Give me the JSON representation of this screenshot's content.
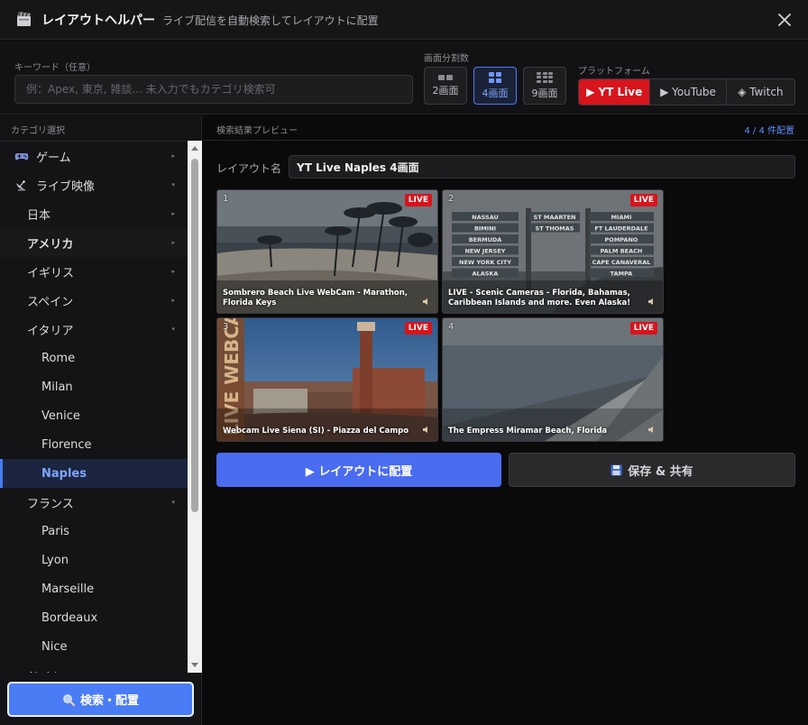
{
  "header": {
    "title": "レイアウトヘルパー",
    "subtitle": "ライブ配信を自動検索してレイアウトに配置",
    "app_icon": "clapper-board-icon",
    "close_icon": "close-icon"
  },
  "controls": {
    "keyword_label": "キーワード（任意）",
    "keyword_placeholder": "例：Apex, 東京, 雑談... 未入力でもカテゴリ検索可",
    "keyword_value": "",
    "split_label": "画面分割数",
    "splits": [
      {
        "label": "2画面",
        "active": false
      },
      {
        "label": "4画面",
        "active": true
      },
      {
        "label": "9画面",
        "active": false
      }
    ],
    "platform_label": "プラットフォーム",
    "platforms": [
      {
        "label": "▶ YT Live",
        "active": true
      },
      {
        "label": "▶ YouTube",
        "active": false
      },
      {
        "label": "◈ Twitch",
        "active": false
      }
    ]
  },
  "sidebar": {
    "heading": "カテゴリ選択",
    "items": [
      {
        "label": "ゲーム",
        "level": 0,
        "arrow": "▸",
        "icon": "gamepad-icon"
      },
      {
        "label": "ライブ映像",
        "level": 0,
        "arrow": "▾",
        "icon": "satellite-dish-icon"
      },
      {
        "label": "日本",
        "level": 1,
        "arrow": "▸"
      },
      {
        "label": "アメリカ",
        "level": 1,
        "arrow": "▸",
        "bold": true
      },
      {
        "label": "イギリス",
        "level": 1,
        "arrow": "▸"
      },
      {
        "label": "スペイン",
        "level": 1,
        "arrow": "▸"
      },
      {
        "label": "イタリア",
        "level": 1,
        "arrow": "▾"
      },
      {
        "label": "Rome",
        "level": 2
      },
      {
        "label": "Milan",
        "level": 2
      },
      {
        "label": "Venice",
        "level": 2
      },
      {
        "label": "Florence",
        "level": 2
      },
      {
        "label": "Naples",
        "level": 2,
        "selected": true
      },
      {
        "label": "フランス",
        "level": 1,
        "arrow": "▾"
      },
      {
        "label": "Paris",
        "level": 2
      },
      {
        "label": "Lyon",
        "level": 2
      },
      {
        "label": "Marseille",
        "level": 2
      },
      {
        "label": "Bordeaux",
        "level": 2
      },
      {
        "label": "Nice",
        "level": 2
      },
      {
        "label": "ドイツ",
        "level": 1,
        "arrow": "▾"
      }
    ],
    "search_button": "検索・配置",
    "search_icon": "magnifier-icon"
  },
  "main": {
    "preview_label": "検索結果プレビュー",
    "count": "4 / 4 件配置",
    "layout_name_label": "レイアウト名",
    "layout_name_value": "YT Live Naples 4画面",
    "tiles": [
      {
        "num": "1",
        "badge": "LIVE",
        "caption": "Sombrero Beach Live WebCam - Marathon, Florida Keys"
      },
      {
        "num": "2",
        "badge": "LIVE",
        "caption": "LIVE - Scenic Cameras - Florida, Bahamas, Caribbean Islands and more. Even Alaska!"
      },
      {
        "num": "3",
        "badge": "LIVE",
        "caption": "Webcam Live Siena (SI) - Piazza del Campo"
      },
      {
        "num": "4",
        "badge": "LIVE",
        "caption": "The Empress Miramar Beach, Florida"
      }
    ],
    "signpost_left": [
      "NASSAU",
      "BIMINI",
      "BERMUDA",
      "NEW JERSEY",
      "NEW YORK CITY",
      "ALASKA"
    ],
    "signpost_mid": [
      "ST MAARTEN",
      "ST THOMAS"
    ],
    "signpost_right": [
      "MIAMI",
      "FT LAUDERDALE",
      "POMPANO",
      "PALM BEACH",
      "CAPE CANAVERAL",
      "TAMPA"
    ],
    "webcam_banner": "LIVE WEBCAM",
    "apply_button": "▶ レイアウトに配置",
    "save_button": "保存 & 共有",
    "save_icon": "floppy-disk-icon"
  },
  "colors": {
    "accent": "#4a7cf5",
    "live_red": "#d8141c",
    "bg": "#0b0b0d"
  }
}
